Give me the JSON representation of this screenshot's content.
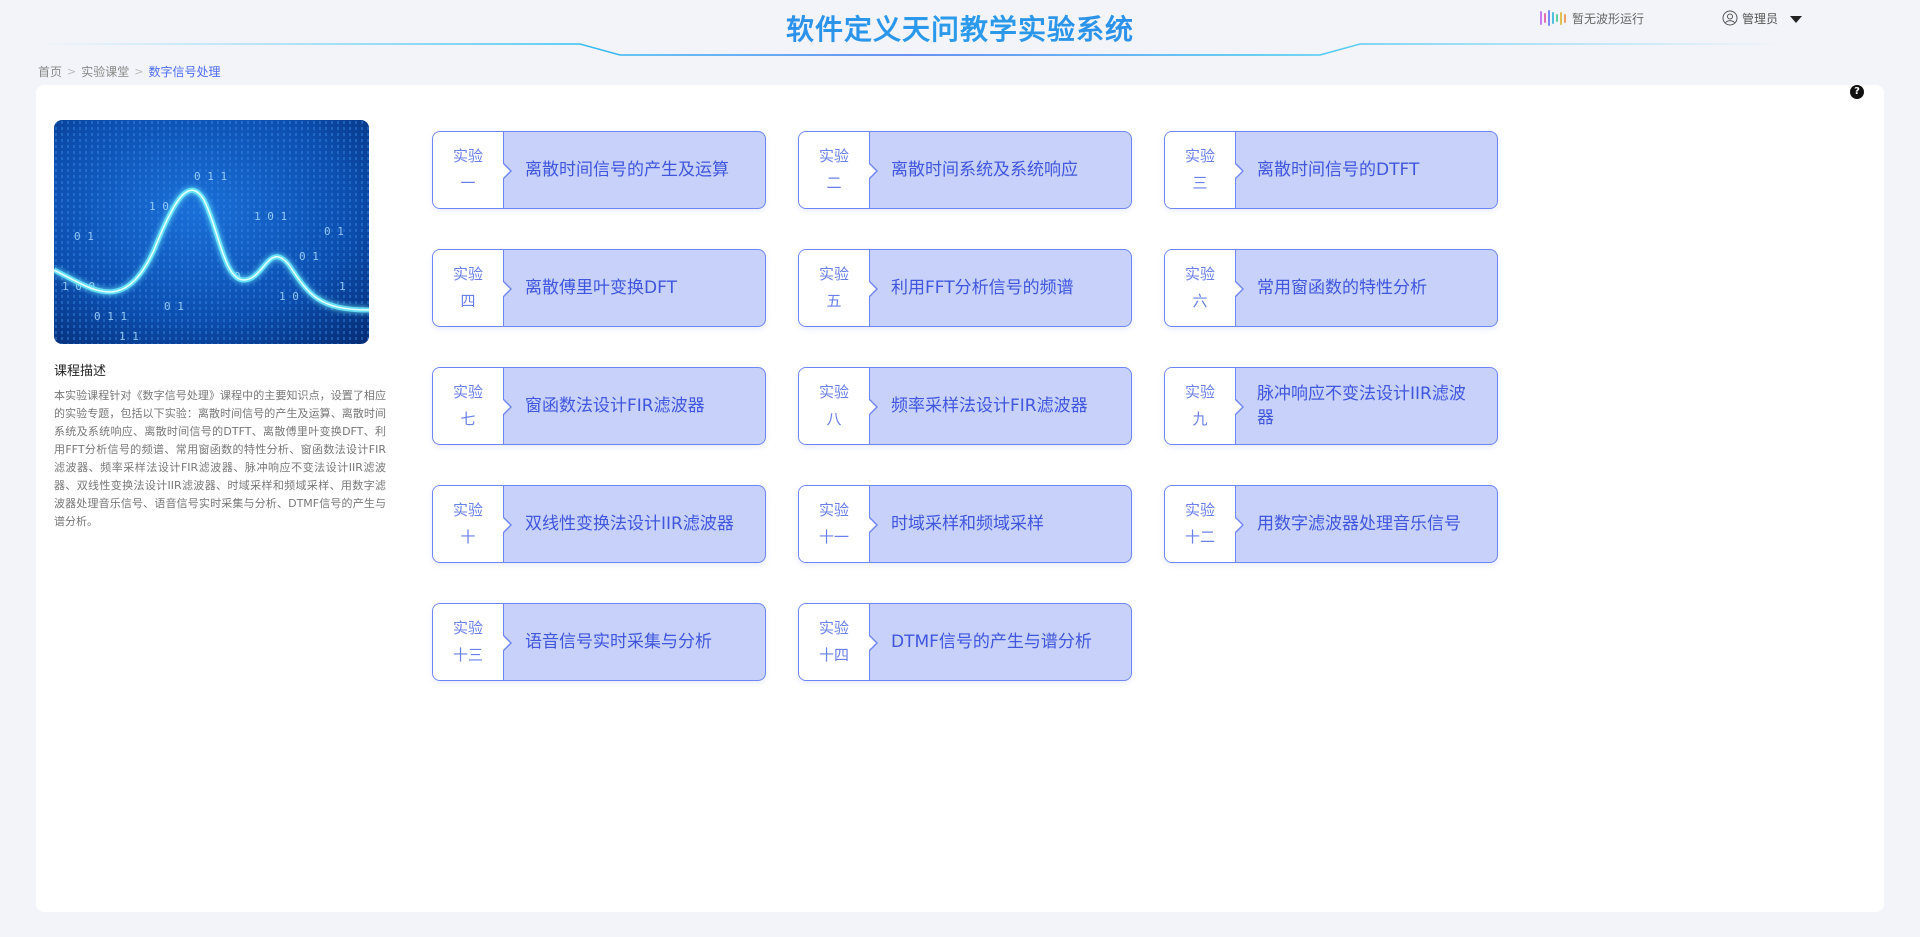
{
  "header": {
    "app_title": "软件定义天问教学实验系统",
    "wave_status": "暂无波形运行",
    "user_name": "管理员"
  },
  "breadcrumb": {
    "home": "首页",
    "classroom": "实验课堂",
    "current": "数字信号处理"
  },
  "course": {
    "cover_alt": "数字信号处理课程封面",
    "desc_title": "课程描述",
    "description": "本实验课程针对《数字信号处理》课程中的主要知识点，设置了相应的实验专题，包括以下实验：离散时间信号的产生及运算、离散时间系统及系统响应、离散时间信号的DTFT、离散傅里叶变换DFT、利用FFT分析信号的频谱、常用窗函数的特性分析、窗函数法设计FIR滤波器、频率采样法设计FIR滤波器、脉冲响应不变法设计IIR滤波器、双线性变换法设计IIR滤波器、时域采样和频域采样、用数字滤波器处理音乐信号、语音信号实时采集与分析、DTMF信号的产生与谱分析。"
  },
  "experiments": [
    {
      "prefix": "实验",
      "num": "一",
      "title": "离散时间信号的产生及运算"
    },
    {
      "prefix": "实验",
      "num": "二",
      "title": "离散时间系统及系统响应"
    },
    {
      "prefix": "实验",
      "num": "三",
      "title": "离散时间信号的DTFT"
    },
    {
      "prefix": "实验",
      "num": "四",
      "title": "离散傅里叶变换DFT"
    },
    {
      "prefix": "实验",
      "num": "五",
      "title": "利用FFT分析信号的频谱"
    },
    {
      "prefix": "实验",
      "num": "六",
      "title": "常用窗函数的特性分析"
    },
    {
      "prefix": "实验",
      "num": "七",
      "title": "窗函数法设计FIR滤波器"
    },
    {
      "prefix": "实验",
      "num": "八",
      "title": "频率采样法设计FIR滤波器"
    },
    {
      "prefix": "实验",
      "num": "九",
      "title": "脉冲响应不变法设计IIR滤波器"
    },
    {
      "prefix": "实验",
      "num": "十",
      "title": "双线性变换法设计IIR滤波器"
    },
    {
      "prefix": "实验",
      "num": "十一",
      "title": "时域采样和频域采样"
    },
    {
      "prefix": "实验",
      "num": "十二",
      "title": "用数字滤波器处理音乐信号"
    },
    {
      "prefix": "实验",
      "num": "十三",
      "title": "语音信号实时采集与分析"
    },
    {
      "prefix": "实验",
      "num": "十四",
      "title": "DTMF信号的产生与谱分析"
    }
  ],
  "colors": {
    "accent": "#4d6cf0",
    "card_bg": "#c8d1fa",
    "card_border": "#6e86f3",
    "card_text": "#3f56dd"
  },
  "icons": {
    "wave": "waveform-icon",
    "user": "user-circle-icon",
    "dropdown": "caret-down-icon",
    "help": "question-circle-icon",
    "breadcrumb_sep": "chevron-right-icon"
  }
}
